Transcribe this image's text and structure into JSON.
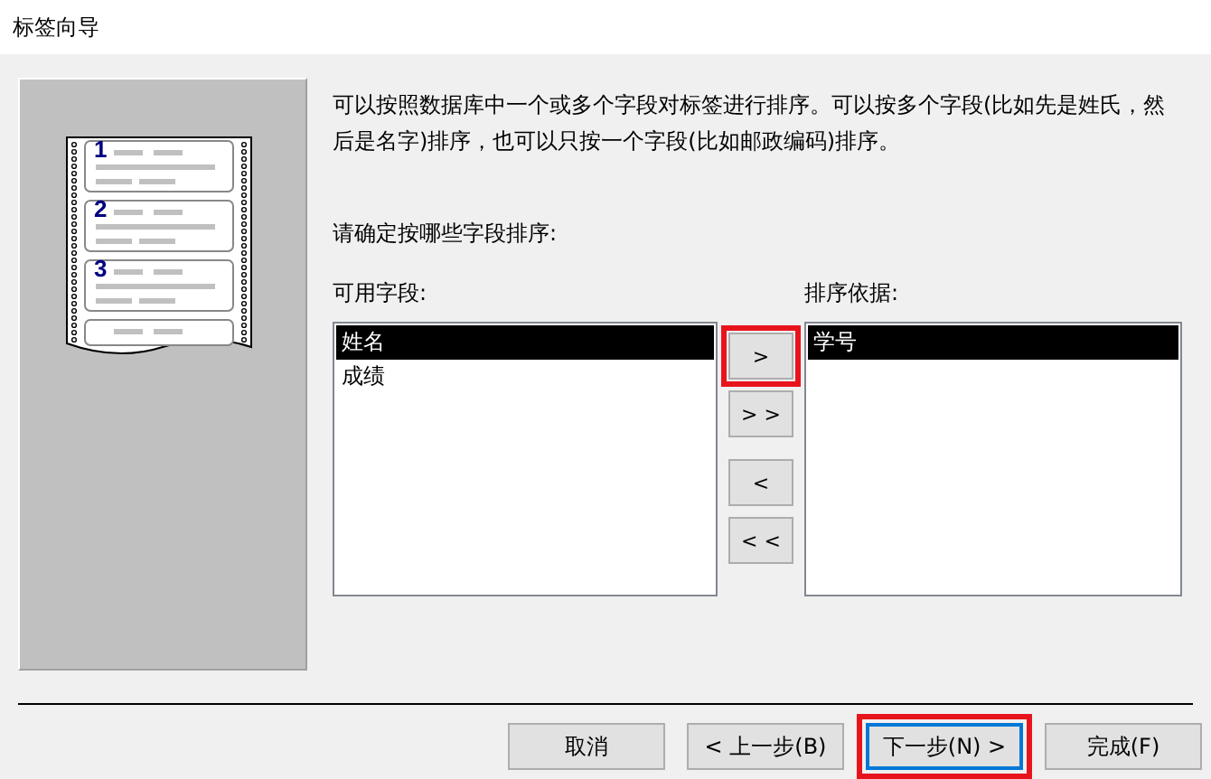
{
  "window": {
    "title": "标签向导"
  },
  "illustration": {
    "numbers": [
      "1",
      "2",
      "3"
    ]
  },
  "description": "可以按照数据库中一个或多个字段对标签进行排序。可以按多个字段(比如先是姓氏，然后是名字)排序，也可以只按一个字段(比如邮政编码)排序。",
  "prompt": "请确定按哪些字段排序:",
  "available_fields": {
    "label": "可用字段:",
    "items": [
      {
        "text": "姓名",
        "selected": true
      },
      {
        "text": "成绩",
        "selected": false
      }
    ]
  },
  "move_buttons": [
    {
      "label": ">",
      "highlighted": true
    },
    {
      "label": "> >",
      "highlighted": false
    },
    {
      "label": "<",
      "highlighted": false
    },
    {
      "label": "< <",
      "highlighted": false
    }
  ],
  "sort_by": {
    "label": "排序依据:",
    "items": [
      {
        "text": "学号",
        "selected": true
      }
    ]
  },
  "footer_buttons": [
    {
      "label": "取消",
      "default": false,
      "highlighted": false
    },
    {
      "label": "< 上一步(B)",
      "default": false,
      "highlighted": false
    },
    {
      "label": "下一步(N) >",
      "default": true,
      "highlighted": true
    },
    {
      "label": "完成(F)",
      "default": false,
      "highlighted": false
    }
  ]
}
